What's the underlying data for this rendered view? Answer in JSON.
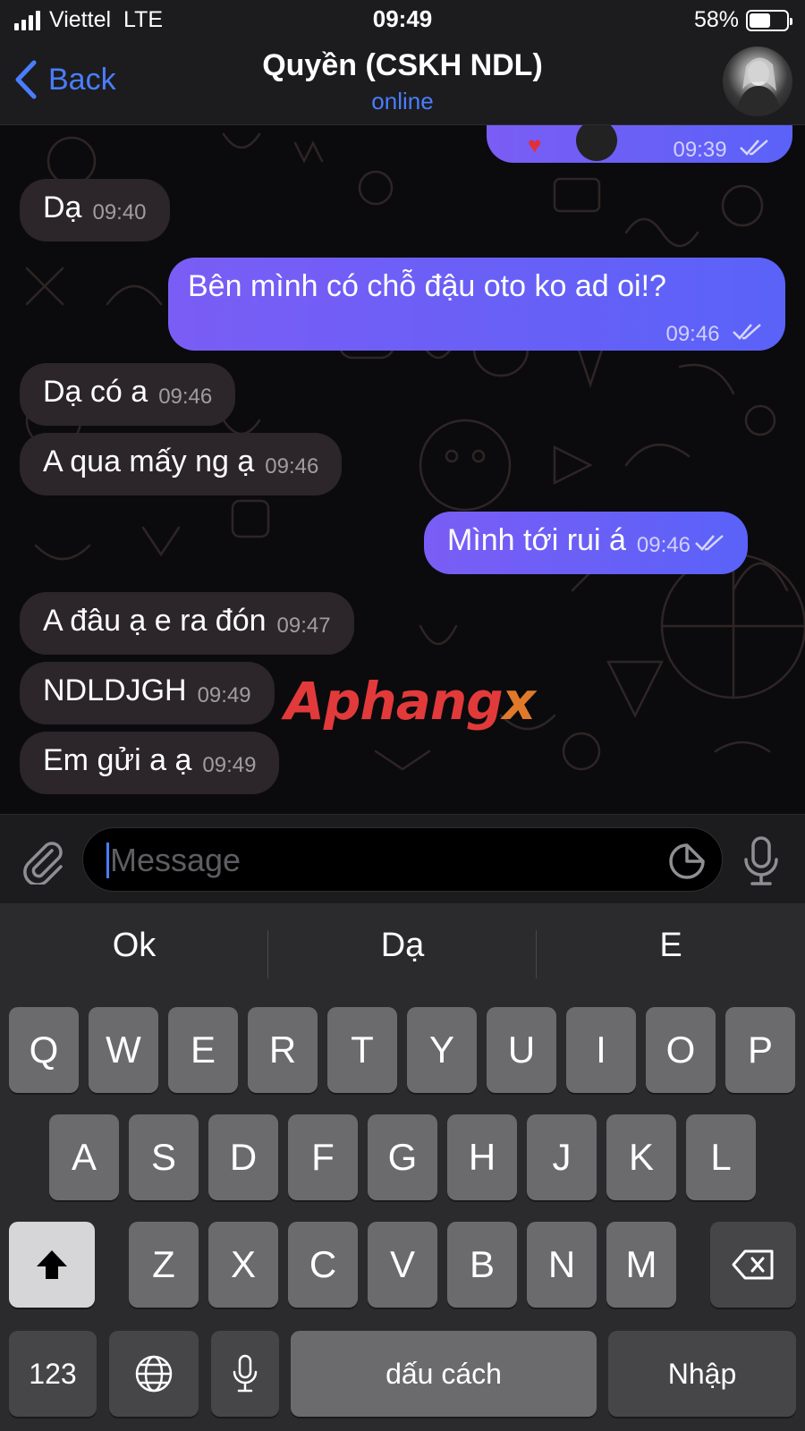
{
  "status_bar": {
    "carrier": "Viettel",
    "network": "LTE",
    "time": "09:49",
    "battery": "58%",
    "battery_level": 0.58
  },
  "header": {
    "back_label": "Back",
    "title": "Quyền (CSKH NDL)",
    "status": "online"
  },
  "messages": [
    {
      "dir": "out",
      "text": "",
      "time": "09:39",
      "partial": true
    },
    {
      "dir": "in",
      "text": "Dạ",
      "time": "09:40"
    },
    {
      "dir": "out",
      "text": "Bên mình có chỗ đậu oto ko ad oi!?",
      "time": "09:46"
    },
    {
      "dir": "in",
      "text": "Dạ có a",
      "time": "09:46"
    },
    {
      "dir": "in",
      "text": "A qua mấy ng ạ",
      "time": "09:46"
    },
    {
      "dir": "out",
      "text": "Mình tới rui á",
      "time": "09:46"
    },
    {
      "dir": "in",
      "text": "A đâu ạ e ra đón",
      "time": "09:47"
    },
    {
      "dir": "in",
      "text": "NDLDJGH",
      "time": "09:49"
    },
    {
      "dir": "in",
      "text": "Em gửi a ạ",
      "time": "09:49"
    }
  ],
  "watermark": {
    "part1": "Aphang",
    "part2": "x"
  },
  "input": {
    "placeholder": "Message"
  },
  "keyboard": {
    "suggestions": [
      "Ok",
      "Dạ",
      "E"
    ],
    "row1": [
      "Q",
      "W",
      "E",
      "R",
      "T",
      "Y",
      "U",
      "I",
      "O",
      "P"
    ],
    "row2": [
      "A",
      "S",
      "D",
      "F",
      "G",
      "H",
      "J",
      "K",
      "L"
    ],
    "row3": [
      "Z",
      "X",
      "C",
      "V",
      "B",
      "N",
      "M"
    ],
    "numbers_label": "123",
    "space_label": "dấu cách",
    "return_label": "Nhập"
  },
  "colors": {
    "accent": "#4a7dff",
    "outgoing_bubble": "#6a5ff6",
    "incoming_bubble": "#2c2529"
  }
}
